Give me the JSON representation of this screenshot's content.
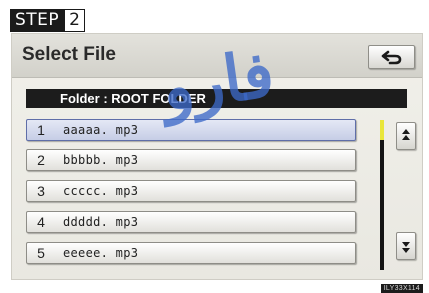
{
  "step": {
    "label": "STEP",
    "number": "2"
  },
  "header": {
    "title": "Select File"
  },
  "folder": {
    "label": "Folder : ROOT FOLDER"
  },
  "files": [
    {
      "num": "1",
      "name": "aaaaa. mp3",
      "selected": true
    },
    {
      "num": "2",
      "name": "bbbbb. mp3",
      "selected": false
    },
    {
      "num": "3",
      "name": "ccccc. mp3",
      "selected": false
    },
    {
      "num": "4",
      "name": "ddddd. mp3",
      "selected": false
    },
    {
      "num": "5",
      "name": "eeeee. mp3",
      "selected": false
    }
  ],
  "icons": {
    "back": "return-arrow-icon",
    "scroll_up": "double-arrow-up-icon",
    "scroll_down": "double-arrow-down-icon"
  },
  "colors": {
    "selected_row": "#c6cde6",
    "scroll_thumb": "#e9e63a",
    "bar": "#1c1c1c"
  },
  "image_code": "ILY33X114",
  "watermark": "فارو"
}
